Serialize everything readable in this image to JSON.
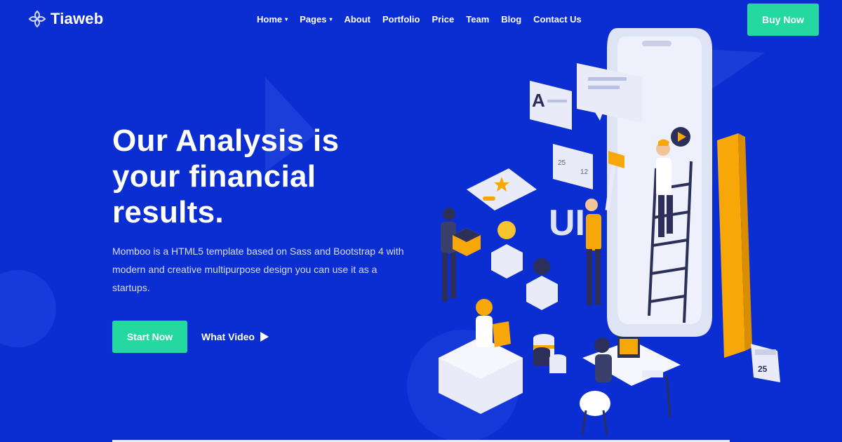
{
  "brand": {
    "name": "Tiaweb"
  },
  "nav": {
    "items": [
      {
        "label": "Home",
        "has_dropdown": true
      },
      {
        "label": "Pages",
        "has_dropdown": true
      },
      {
        "label": "About"
      },
      {
        "label": "Portfolio"
      },
      {
        "label": "Price"
      },
      {
        "label": "Team"
      },
      {
        "label": "Blog"
      },
      {
        "label": "Contact Us"
      }
    ],
    "caret": "▾"
  },
  "header": {
    "buy_label": "Buy Now"
  },
  "hero": {
    "title_line1": "Our Analysis is",
    "title_line2": "your financial",
    "title_line3": "results.",
    "desc_line1": "Momboo is a HTML5 template based on Sass and Bootstrap 4 with",
    "desc_line2": "modern and creative multipurpose design you can use it as a",
    "desc_line3": "startups.",
    "start_label": "Start Now",
    "video_label": "What Video"
  },
  "illustration": {
    "card_letter": "A",
    "likes": "25",
    "comments": "12",
    "ui_text": "UI",
    "calendar_day": "25"
  },
  "colors": {
    "background": "#0b2ed3",
    "accent": "#24d9a0",
    "orange": "#f7a707",
    "white": "#ffffff"
  }
}
